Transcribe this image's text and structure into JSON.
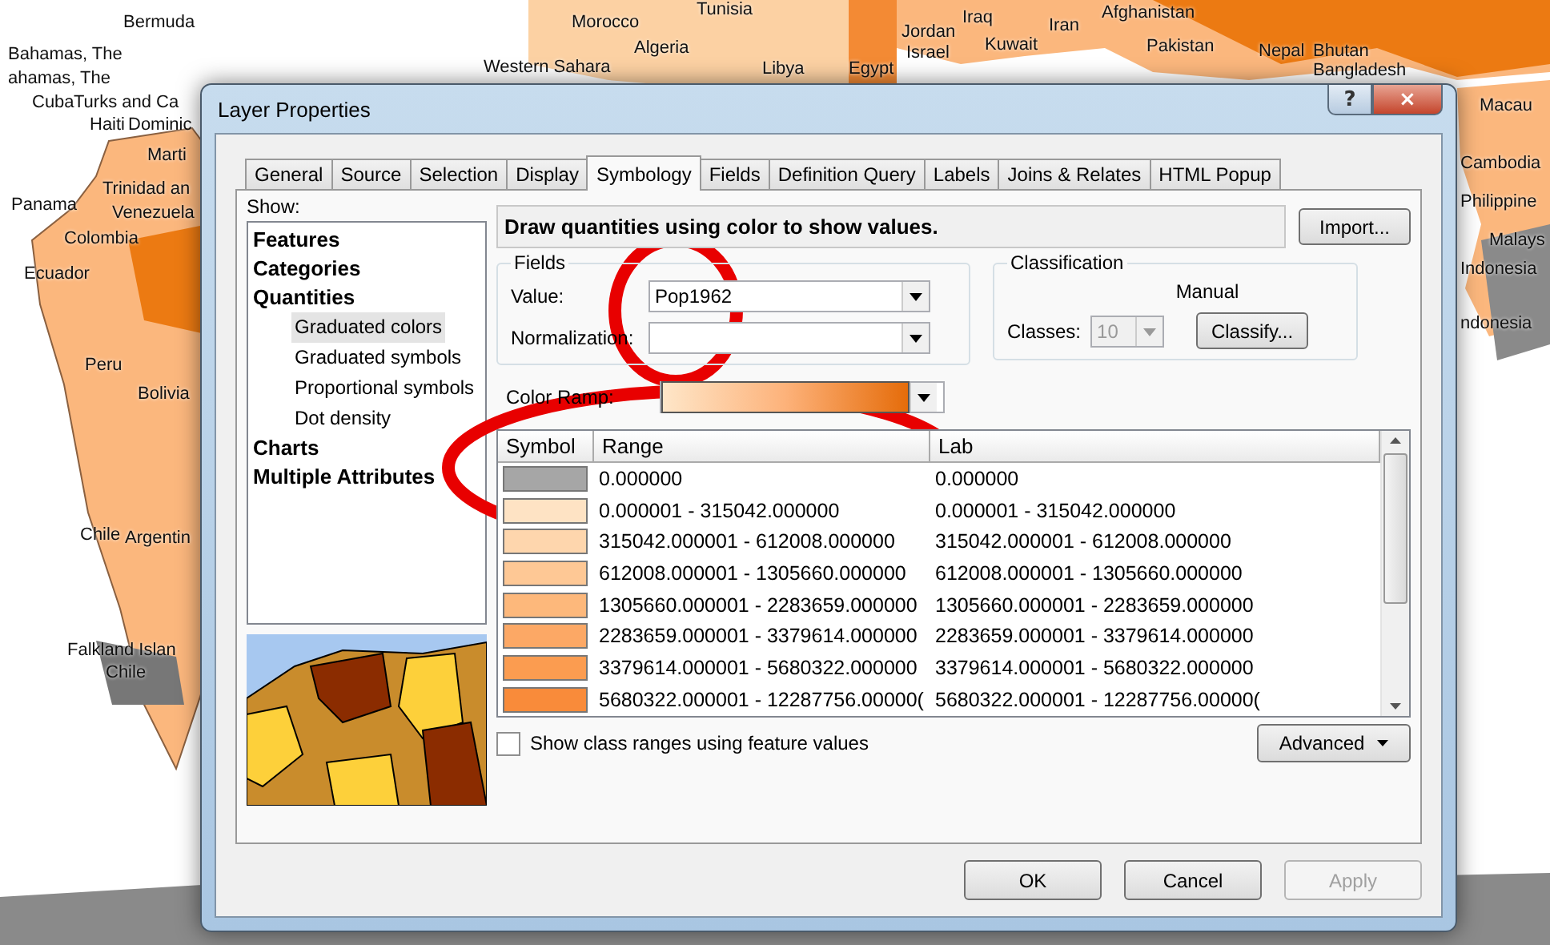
{
  "map": {
    "labels": [
      "Bermuda",
      "Bahamas, The",
      "ahamas, The",
      "Cuba",
      "Turks and Ca",
      "Haiti",
      "Dominic",
      "Marti",
      "Trinidad an",
      "Venezuela",
      "Panama",
      "Colombia",
      "Ecuador",
      "Peru",
      "Bolivia",
      "Chile",
      "Argentin",
      "Falkland Islan",
      "Chile",
      "Western Sahara",
      "Morocco",
      "Tunisia",
      "Algeria",
      "Libya",
      "Egypt",
      "Jordan",
      "Israel",
      "Iraq",
      "Kuwait",
      "Iran",
      "Afghanistan",
      "Pakistan",
      "Nepal",
      "Bhutan",
      "Bangladesh",
      "Macau",
      "Cambodia",
      "Philippine",
      "Malays",
      "Indonesia",
      "ndonesia"
    ]
  },
  "window": {
    "title": "Layer Properties",
    "help": "?",
    "close": "×"
  },
  "tabs": [
    {
      "label": "General",
      "selected": false
    },
    {
      "label": "Source",
      "selected": false
    },
    {
      "label": "Selection",
      "selected": false
    },
    {
      "label": "Display",
      "selected": false
    },
    {
      "label": "Symbology",
      "selected": true
    },
    {
      "label": "Fields",
      "selected": false
    },
    {
      "label": "Definition Query",
      "selected": false
    },
    {
      "label": "Labels",
      "selected": false
    },
    {
      "label": "Joins & Relates",
      "selected": false
    },
    {
      "label": "HTML Popup",
      "selected": false
    }
  ],
  "show": {
    "label": "Show:",
    "items": [
      {
        "label": "Features",
        "selected": false
      },
      {
        "label": "Categories",
        "selected": false
      },
      {
        "label": "Quantities",
        "selected": false,
        "children": [
          {
            "label": "Graduated colors",
            "selected": true
          },
          {
            "label": "Graduated symbols",
            "selected": false
          },
          {
            "label": "Proportional symbols",
            "selected": false
          },
          {
            "label": "Dot density",
            "selected": false
          }
        ]
      },
      {
        "label": "Charts",
        "selected": false
      },
      {
        "label": "Multiple Attributes",
        "selected": false
      }
    ]
  },
  "description": "Draw quantities using color to show values.",
  "import_button": "Import...",
  "fields": {
    "title": "Fields",
    "value_label": "Value:",
    "value": "Pop1962",
    "normalization_label": "Normalization:"
  },
  "classification": {
    "title": "Classification",
    "method": "Manual",
    "classes_label": "Classes:",
    "classes": "10",
    "classes_disabled": true,
    "classify_button": "Classify..."
  },
  "color_ramp": {
    "label": "Color Ramp:"
  },
  "table": {
    "columns": [
      "Symbol",
      "Range",
      "Lab"
    ],
    "rows": [
      {
        "color": "#a6a6a6",
        "range": "0.000000",
        "label": "0.000000"
      },
      {
        "color": "#fee3c4",
        "range": "0.000001 - 315042.000000",
        "label": "0.000001 - 315042.000000"
      },
      {
        "color": "#fed6ad",
        "range": "315042.000001 - 612008.000000",
        "label": "315042.000001 - 612008.000000"
      },
      {
        "color": "#fec895",
        "range": "612008.000001 - 1305660.000000",
        "label": "612008.000001 - 1305660.000000"
      },
      {
        "color": "#fdb87b",
        "range": "1305660.000001 - 2283659.000000",
        "label": "1305660.000001 - 2283659.000000"
      },
      {
        "color": "#fca865",
        "range": "2283659.000001 - 3379614.000000",
        "label": "2283659.000001 - 3379614.000000"
      },
      {
        "color": "#fb9c50",
        "range": "3379614.000001 - 5680322.000000",
        "label": "3379614.000001 - 5680322.000000"
      },
      {
        "color": "#f98b3a",
        "range": "5680322.000001 - 12287756.00000(",
        "label": "5680322.000001 - 12287756.00000("
      }
    ]
  },
  "show_class_ranges": {
    "label": "Show class ranges using feature values",
    "checked": false
  },
  "advanced_button": "Advanced",
  "buttons": [
    {
      "label": "OK",
      "disabled": false
    },
    {
      "label": "Cancel",
      "disabled": false
    },
    {
      "label": "Apply",
      "disabled": true
    }
  ]
}
